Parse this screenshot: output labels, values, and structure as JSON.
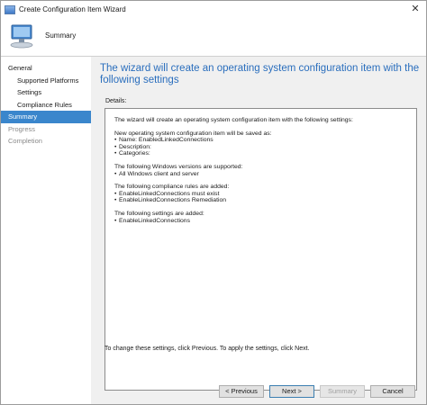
{
  "window": {
    "title": "Create Configuration Item Wizard",
    "close_glyph": "✕"
  },
  "header": {
    "title": "Summary",
    "icon": "computer-icon"
  },
  "sidebar": {
    "items": [
      {
        "label": "General",
        "level": "top",
        "state": "normal"
      },
      {
        "label": "Supported Platforms",
        "level": "child",
        "state": "normal"
      },
      {
        "label": "Settings",
        "level": "child",
        "state": "normal"
      },
      {
        "label": "Compliance Rules",
        "level": "child",
        "state": "normal"
      },
      {
        "label": "Summary",
        "level": "top",
        "state": "selected"
      },
      {
        "label": "Progress",
        "level": "top",
        "state": "dim"
      },
      {
        "label": "Completion",
        "level": "top",
        "state": "dim"
      }
    ]
  },
  "main": {
    "heading": "The wizard will create an operating system configuration item with the following settings",
    "details_label": "Details:",
    "details": {
      "intro": "The wizard will create an operating system configuration item with the following settings:",
      "save_header": "New operating system configuration item will be saved as:",
      "name": "Name: EnabledLinkedConnections",
      "description": "Description:",
      "categories": "Categories:",
      "versions_header": "The following Windows versions are supported:",
      "version_1": "All Windows client and server",
      "rules_header": "The following compliance rules are added:",
      "rule_1": "EnableLinkedConnections must exist",
      "rule_2": "EnableLinkedConnections Remediation",
      "settings_header": "The following settings are added:",
      "setting_1": "EnableLinkedConnections"
    },
    "footer_note": "To change these settings, click Previous. To apply the settings, click Next."
  },
  "buttons": {
    "previous": "< Previous",
    "next": "Next >",
    "summary": "Summary",
    "cancel": "Cancel"
  },
  "colors": {
    "heading": "#2a6ebd",
    "selected_nav": "#3a86cc"
  }
}
